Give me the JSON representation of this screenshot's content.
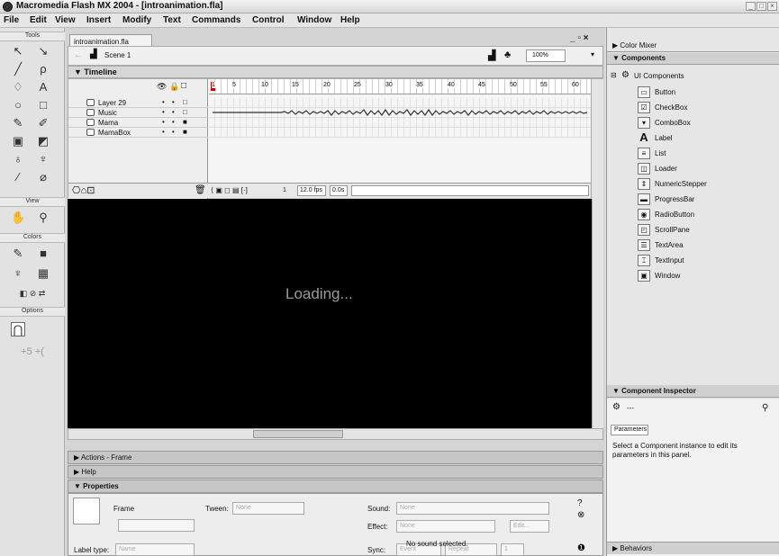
{
  "window": {
    "title": "Macromedia Flash MX 2004 - [introanimation.fla]"
  },
  "menu": [
    "File",
    "Edit",
    "View",
    "Insert",
    "Modify",
    "Text",
    "Commands",
    "Control",
    "Window",
    "Help"
  ],
  "tools": {
    "header": "Tools",
    "view": "View",
    "colors": "Colors",
    "options": "Options"
  },
  "document": {
    "tab": "introanimation.fla",
    "scene": "Scene 1",
    "zoom": "100%"
  },
  "timeline": {
    "title": "Timeline",
    "ruler": [
      "1",
      "5",
      "10",
      "15",
      "20",
      "25",
      "30",
      "35",
      "40",
      "45",
      "50",
      "55",
      "60"
    ],
    "layers": [
      {
        "name": "Layer 29"
      },
      {
        "name": "Music"
      },
      {
        "name": "Mama"
      },
      {
        "name": "MamaBox"
      }
    ],
    "frame": "1",
    "fps": "12.0 fps",
    "time": "0.0s"
  },
  "stage": {
    "loading": "Loading..."
  },
  "panels": {
    "actions": "Actions - Frame",
    "help": "Help",
    "properties": "Properties"
  },
  "properties": {
    "frame_label": "Frame",
    "tween_label": "Tween:",
    "tween_value": "None",
    "sound_label": "Sound:",
    "sound_value": "None",
    "effect_label": "Effect:",
    "effect_value": "None",
    "edit": "Edit...",
    "sync_label": "Sync:",
    "sync_value": "Event",
    "repeat_value": "Repeat",
    "repeat_count": "1",
    "label_type": "Label type:",
    "label_type_value": "Name",
    "no_sound": "No sound selected."
  },
  "right": {
    "color_mixer": "Color Mixer",
    "components": "Components",
    "ui_components": "UI Components",
    "items": [
      "Button",
      "CheckBox",
      "ComboBox",
      "Label",
      "List",
      "Loader",
      "NumericStepper",
      "ProgressBar",
      "RadioButton",
      "ScrollPane",
      "TextArea",
      "TextInput",
      "Window"
    ],
    "inspector": "Component Inspector",
    "inspector_dash": "---",
    "parameters_tab": "Parameters",
    "inspector_msg": "Select a Component instance to edit its parameters in this panel.",
    "behaviors": "Behaviors"
  }
}
